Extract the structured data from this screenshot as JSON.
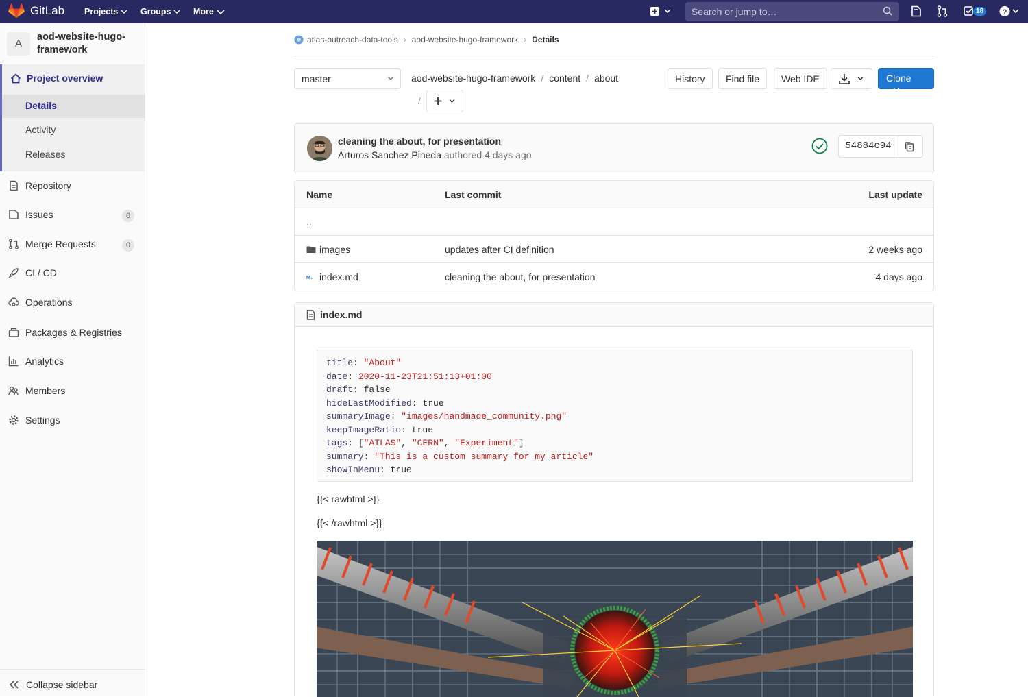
{
  "topbar": {
    "brand": "GitLab",
    "nav": [
      "Projects",
      "Groups",
      "More"
    ],
    "search_placeholder": "Search or jump to…",
    "todo_count": "18",
    "colors": {
      "bg": "#292961",
      "accent": "#1f78d1"
    }
  },
  "sidebar": {
    "avatar_letter": "A",
    "project_name_line1": "aod-website-hugo-",
    "project_name_line2": "framework",
    "overview": {
      "label": "Project overview",
      "sub": [
        "Details",
        "Activity",
        "Releases"
      ]
    },
    "items": [
      {
        "label": "Repository",
        "icon": "doc-icon"
      },
      {
        "label": "Issues",
        "icon": "issues-icon",
        "count": "0"
      },
      {
        "label": "Merge Requests",
        "icon": "merge-request-icon",
        "count": "0"
      },
      {
        "label": "CI / CD",
        "icon": "rocket-icon"
      },
      {
        "label": "Operations",
        "icon": "cloud-gear-icon"
      },
      {
        "label": "Packages & Registries",
        "icon": "package-icon"
      },
      {
        "label": "Analytics",
        "icon": "chart-icon"
      },
      {
        "label": "Members",
        "icon": "users-icon"
      },
      {
        "label": "Settings",
        "icon": "gear-icon"
      }
    ],
    "collapse_label": "Collapse sidebar"
  },
  "breadcrumb": {
    "group": "atlas-outreach-data-tools",
    "project": "aod-website-hugo-framework",
    "current": "Details"
  },
  "toolbar": {
    "branch": "master",
    "path": [
      "aod-website-hugo-framework",
      "content",
      "about"
    ],
    "history_label": "History",
    "find_file_label": "Find file",
    "web_ide_label": "Web IDE",
    "clone_label": "Clone"
  },
  "commit": {
    "title": "cleaning the about, for presentation",
    "author": "Arturos Sanchez Pineda",
    "authored_text": "authored 4 days ago",
    "sha": "54884c94",
    "status": "passed"
  },
  "files_table": {
    "headers": [
      "Name",
      "Last commit",
      "Last update"
    ],
    "parent_link": "..",
    "rows": [
      {
        "name": "images",
        "icon": "folder-icon",
        "commit": "updates after CI definition",
        "updated": "2 weeks ago"
      },
      {
        "name": "index.md",
        "icon": "markdown-icon",
        "commit": "cleaning the about, for presentation",
        "updated": "4 days ago"
      }
    ]
  },
  "readme": {
    "filename": "index.md",
    "front_matter": [
      {
        "key": "title",
        "value": "\"About\"",
        "type": "s"
      },
      {
        "key": "date",
        "value": "2020-11-23T21:51:13+01:00",
        "type": "s"
      },
      {
        "key": "draft",
        "value": "false",
        "type": "v"
      },
      {
        "key": "hideLastModified",
        "value": "true",
        "type": "v"
      },
      {
        "key": "summaryImage",
        "value": "\"images/handmade_community.png\"",
        "type": "s"
      },
      {
        "key": "keepImageRatio",
        "value": "true",
        "type": "v"
      },
      {
        "key": "tags",
        "value": "[\"ATLAS\", \"CERN\", \"Experiment\"]",
        "type": "tags"
      },
      {
        "key": "summary",
        "value": "\"This is a custom summary for my article\"",
        "type": "s"
      },
      {
        "key": "showInMenu",
        "value": "true",
        "type": "v"
      }
    ],
    "raw_open": "{{< rawhtml >}}",
    "raw_close": "{{< /rawhtml >}}"
  }
}
